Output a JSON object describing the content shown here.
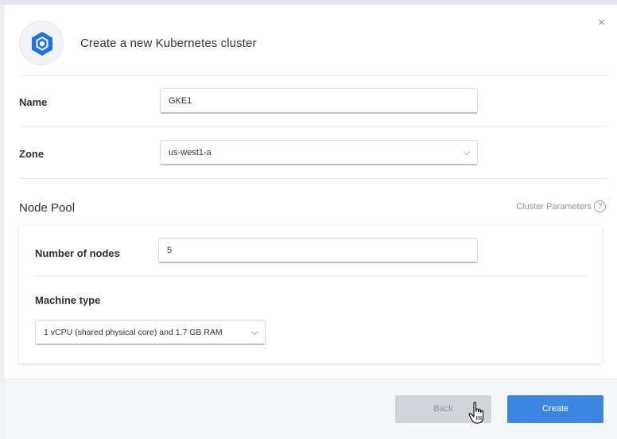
{
  "dialog": {
    "title": "Create a new Kubernetes cluster",
    "close_symbol": "×",
    "logo_icon": "gke-hexagon-icon",
    "accent_color": "#3d86e0"
  },
  "form": {
    "name_label": "Name",
    "name_value": "GKE1",
    "zone_label": "Zone",
    "zone_value": "us-west1-a"
  },
  "node_pool": {
    "title": "Node Pool",
    "params_link": "Cluster Parameters",
    "help_symbol": "?",
    "nodes_label": "Number of nodes",
    "nodes_value": "5",
    "machine_label": "Machine type",
    "machine_value": "1 vCPU (shared physical core) and 1.7 GB RAM"
  },
  "footer": {
    "back_label": "Back",
    "create_label": "Create"
  }
}
